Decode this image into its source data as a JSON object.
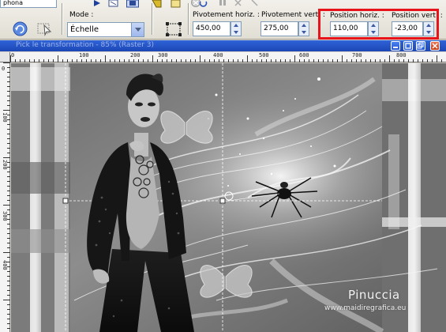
{
  "toolbar": {
    "cut_text": "phona",
    "mode_label": "Mode :",
    "mode_value": "Échelle",
    "pivot_horiz_label": "Pivotement horiz. :",
    "pivot_horiz_value": "450,00",
    "pivot_vert_label": "Pivotement vert. :",
    "pivot_vert_value": "275,00",
    "pos_horiz_label": "Position horiz. :",
    "pos_horiz_value": "110,00",
    "pos_vert_label": "Position vert. :",
    "pos_vert_value": "-23,00"
  },
  "document": {
    "title": "Pick le transformation - 85% (Raster 3)"
  },
  "ruler": {
    "h_labels": [
      "0",
      "100",
      "200",
      "300",
      "400",
      "500",
      "600",
      "700",
      "800"
    ],
    "v_labels": [
      "0",
      "100",
      "200",
      "300",
      "400"
    ]
  },
  "watermark": {
    "name": "Pinuccia",
    "site": "www.maidiregrafica.eu"
  },
  "colors": {
    "highlight": "#e8141b",
    "titlebar": "#2457cf"
  }
}
